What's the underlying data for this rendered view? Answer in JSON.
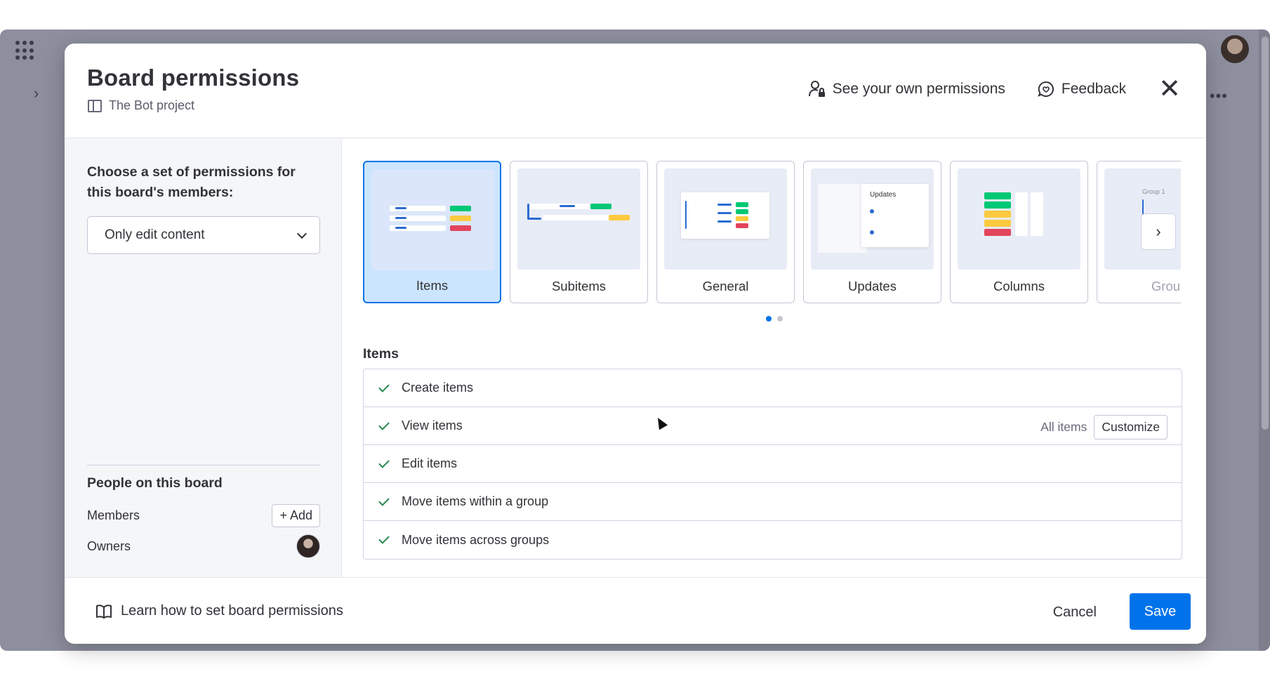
{
  "colors": {
    "accent": "#0073ea",
    "check": "#258750",
    "selected_card_bg": "#cce5ff"
  },
  "header": {
    "title": "Board permissions",
    "board_name": "The Bot project",
    "see_permissions_label": "See your own permissions",
    "feedback_label": "Feedback",
    "close_icon": "close-icon"
  },
  "left_panel": {
    "choose_label": "Choose a set of permissions for this board's members:",
    "selected_option": "Only edit content",
    "people_title": "People on this board",
    "members_label": "Members",
    "add_label": "+ Add",
    "owners_label": "Owners"
  },
  "cards": [
    {
      "label": "Items",
      "selected": true
    },
    {
      "label": "Subitems",
      "selected": false
    },
    {
      "label": "General",
      "selected": false
    },
    {
      "label": "Updates",
      "selected": false,
      "thumb_text": "Updates"
    },
    {
      "label": "Columns",
      "selected": false
    },
    {
      "label": "Grou",
      "selected": false,
      "thumb_text": "Group 1"
    }
  ],
  "pager": {
    "pages": 2,
    "active": 1
  },
  "section": {
    "title": "Items",
    "rows": [
      {
        "label": "Create items"
      },
      {
        "label": "View items",
        "scope": "All items",
        "action": "Customize"
      },
      {
        "label": "Edit items"
      },
      {
        "label": "Move items within a group"
      },
      {
        "label": "Move items across groups"
      }
    ]
  },
  "footer": {
    "learn_label": "Learn how to set board permissions",
    "cancel_label": "Cancel",
    "save_label": "Save"
  }
}
